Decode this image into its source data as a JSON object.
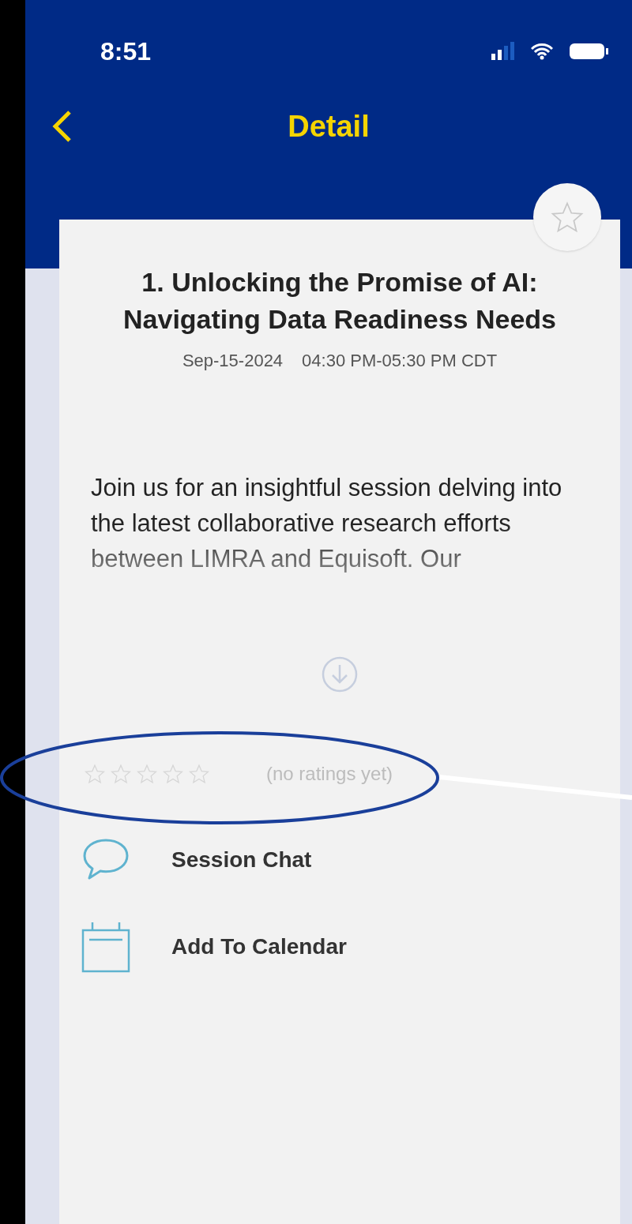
{
  "status_bar": {
    "time": "8:51"
  },
  "nav": {
    "title": "Detail"
  },
  "session": {
    "favorited": false,
    "title": "1. Unlocking the Promise of AI: Navigating Data Readiness Needs",
    "date": "Sep-15-2024",
    "time": "04:30 PM-05:30 PM CDT",
    "description": "Join us for an insightful session delving into the latest collaborative research efforts between LIMRA and Equisoft. Our",
    "rating": {
      "stars": 0,
      "label": "(no ratings yet)"
    }
  },
  "actions": [
    {
      "kind": "chat",
      "label": "Session Chat"
    },
    {
      "kind": "calendar",
      "label": "Add To Calendar"
    }
  ]
}
